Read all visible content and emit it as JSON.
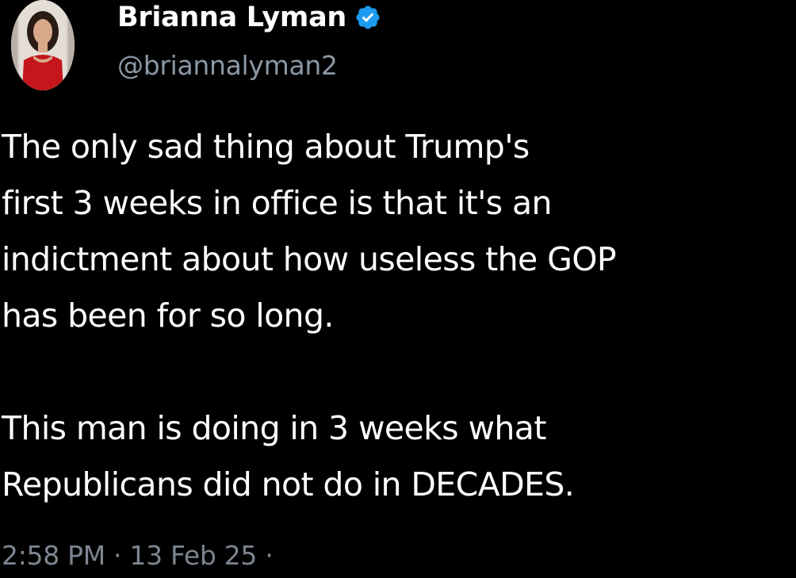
{
  "tweet": {
    "author": {
      "display_name": "Brianna Lyman",
      "handle": "@briannalyman2",
      "verified": true,
      "verified_color": "#1d9bf0",
      "avatar_icon": "profile-photo"
    },
    "text": "The only sad thing about Trump's\nfirst 3 weeks in office is that it's an\nindictment about how useless the GOP\nhas been for so long.\n\nThis man is doing in 3 weeks what\nRepublicans did not do in DECADES.",
    "timestamp": "2:58 PM · 13 Feb 25 ·"
  },
  "colors": {
    "background": "#000000",
    "primary_text": "#ffffff",
    "secondary_text": "#8b98a5"
  }
}
